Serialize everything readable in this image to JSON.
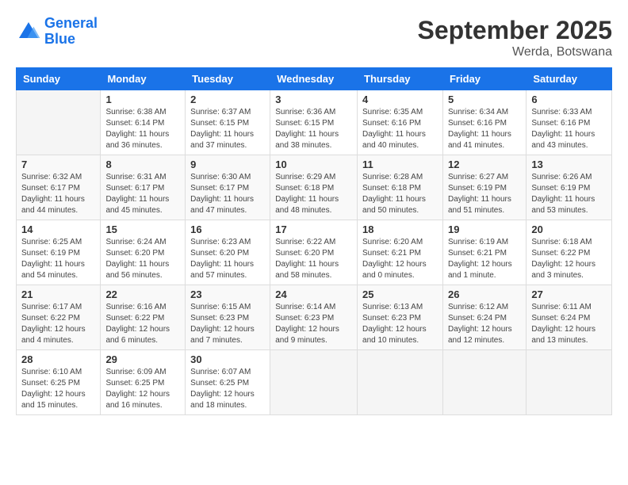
{
  "logo": {
    "line1": "General",
    "line2": "Blue"
  },
  "title": "September 2025",
  "subtitle": "Werda, Botswana",
  "days_of_week": [
    "Sunday",
    "Monday",
    "Tuesday",
    "Wednesday",
    "Thursday",
    "Friday",
    "Saturday"
  ],
  "weeks": [
    [
      {
        "day": "",
        "sunrise": "",
        "sunset": "",
        "daylight": ""
      },
      {
        "day": "1",
        "sunrise": "Sunrise: 6:38 AM",
        "sunset": "Sunset: 6:14 PM",
        "daylight": "Daylight: 11 hours and 36 minutes."
      },
      {
        "day": "2",
        "sunrise": "Sunrise: 6:37 AM",
        "sunset": "Sunset: 6:15 PM",
        "daylight": "Daylight: 11 hours and 37 minutes."
      },
      {
        "day": "3",
        "sunrise": "Sunrise: 6:36 AM",
        "sunset": "Sunset: 6:15 PM",
        "daylight": "Daylight: 11 hours and 38 minutes."
      },
      {
        "day": "4",
        "sunrise": "Sunrise: 6:35 AM",
        "sunset": "Sunset: 6:16 PM",
        "daylight": "Daylight: 11 hours and 40 minutes."
      },
      {
        "day": "5",
        "sunrise": "Sunrise: 6:34 AM",
        "sunset": "Sunset: 6:16 PM",
        "daylight": "Daylight: 11 hours and 41 minutes."
      },
      {
        "day": "6",
        "sunrise": "Sunrise: 6:33 AM",
        "sunset": "Sunset: 6:16 PM",
        "daylight": "Daylight: 11 hours and 43 minutes."
      }
    ],
    [
      {
        "day": "7",
        "sunrise": "Sunrise: 6:32 AM",
        "sunset": "Sunset: 6:17 PM",
        "daylight": "Daylight: 11 hours and 44 minutes."
      },
      {
        "day": "8",
        "sunrise": "Sunrise: 6:31 AM",
        "sunset": "Sunset: 6:17 PM",
        "daylight": "Daylight: 11 hours and 45 minutes."
      },
      {
        "day": "9",
        "sunrise": "Sunrise: 6:30 AM",
        "sunset": "Sunset: 6:17 PM",
        "daylight": "Daylight: 11 hours and 47 minutes."
      },
      {
        "day": "10",
        "sunrise": "Sunrise: 6:29 AM",
        "sunset": "Sunset: 6:18 PM",
        "daylight": "Daylight: 11 hours and 48 minutes."
      },
      {
        "day": "11",
        "sunrise": "Sunrise: 6:28 AM",
        "sunset": "Sunset: 6:18 PM",
        "daylight": "Daylight: 11 hours and 50 minutes."
      },
      {
        "day": "12",
        "sunrise": "Sunrise: 6:27 AM",
        "sunset": "Sunset: 6:19 PM",
        "daylight": "Daylight: 11 hours and 51 minutes."
      },
      {
        "day": "13",
        "sunrise": "Sunrise: 6:26 AM",
        "sunset": "Sunset: 6:19 PM",
        "daylight": "Daylight: 11 hours and 53 minutes."
      }
    ],
    [
      {
        "day": "14",
        "sunrise": "Sunrise: 6:25 AM",
        "sunset": "Sunset: 6:19 PM",
        "daylight": "Daylight: 11 hours and 54 minutes."
      },
      {
        "day": "15",
        "sunrise": "Sunrise: 6:24 AM",
        "sunset": "Sunset: 6:20 PM",
        "daylight": "Daylight: 11 hours and 56 minutes."
      },
      {
        "day": "16",
        "sunrise": "Sunrise: 6:23 AM",
        "sunset": "Sunset: 6:20 PM",
        "daylight": "Daylight: 11 hours and 57 minutes."
      },
      {
        "day": "17",
        "sunrise": "Sunrise: 6:22 AM",
        "sunset": "Sunset: 6:20 PM",
        "daylight": "Daylight: 11 hours and 58 minutes."
      },
      {
        "day": "18",
        "sunrise": "Sunrise: 6:20 AM",
        "sunset": "Sunset: 6:21 PM",
        "daylight": "Daylight: 12 hours and 0 minutes."
      },
      {
        "day": "19",
        "sunrise": "Sunrise: 6:19 AM",
        "sunset": "Sunset: 6:21 PM",
        "daylight": "Daylight: 12 hours and 1 minute."
      },
      {
        "day": "20",
        "sunrise": "Sunrise: 6:18 AM",
        "sunset": "Sunset: 6:22 PM",
        "daylight": "Daylight: 12 hours and 3 minutes."
      }
    ],
    [
      {
        "day": "21",
        "sunrise": "Sunrise: 6:17 AM",
        "sunset": "Sunset: 6:22 PM",
        "daylight": "Daylight: 12 hours and 4 minutes."
      },
      {
        "day": "22",
        "sunrise": "Sunrise: 6:16 AM",
        "sunset": "Sunset: 6:22 PM",
        "daylight": "Daylight: 12 hours and 6 minutes."
      },
      {
        "day": "23",
        "sunrise": "Sunrise: 6:15 AM",
        "sunset": "Sunset: 6:23 PM",
        "daylight": "Daylight: 12 hours and 7 minutes."
      },
      {
        "day": "24",
        "sunrise": "Sunrise: 6:14 AM",
        "sunset": "Sunset: 6:23 PM",
        "daylight": "Daylight: 12 hours and 9 minutes."
      },
      {
        "day": "25",
        "sunrise": "Sunrise: 6:13 AM",
        "sunset": "Sunset: 6:23 PM",
        "daylight": "Daylight: 12 hours and 10 minutes."
      },
      {
        "day": "26",
        "sunrise": "Sunrise: 6:12 AM",
        "sunset": "Sunset: 6:24 PM",
        "daylight": "Daylight: 12 hours and 12 minutes."
      },
      {
        "day": "27",
        "sunrise": "Sunrise: 6:11 AM",
        "sunset": "Sunset: 6:24 PM",
        "daylight": "Daylight: 12 hours and 13 minutes."
      }
    ],
    [
      {
        "day": "28",
        "sunrise": "Sunrise: 6:10 AM",
        "sunset": "Sunset: 6:25 PM",
        "daylight": "Daylight: 12 hours and 15 minutes."
      },
      {
        "day": "29",
        "sunrise": "Sunrise: 6:09 AM",
        "sunset": "Sunset: 6:25 PM",
        "daylight": "Daylight: 12 hours and 16 minutes."
      },
      {
        "day": "30",
        "sunrise": "Sunrise: 6:07 AM",
        "sunset": "Sunset: 6:25 PM",
        "daylight": "Daylight: 12 hours and 18 minutes."
      },
      {
        "day": "",
        "sunrise": "",
        "sunset": "",
        "daylight": ""
      },
      {
        "day": "",
        "sunrise": "",
        "sunset": "",
        "daylight": ""
      },
      {
        "day": "",
        "sunrise": "",
        "sunset": "",
        "daylight": ""
      },
      {
        "day": "",
        "sunrise": "",
        "sunset": "",
        "daylight": ""
      }
    ]
  ]
}
